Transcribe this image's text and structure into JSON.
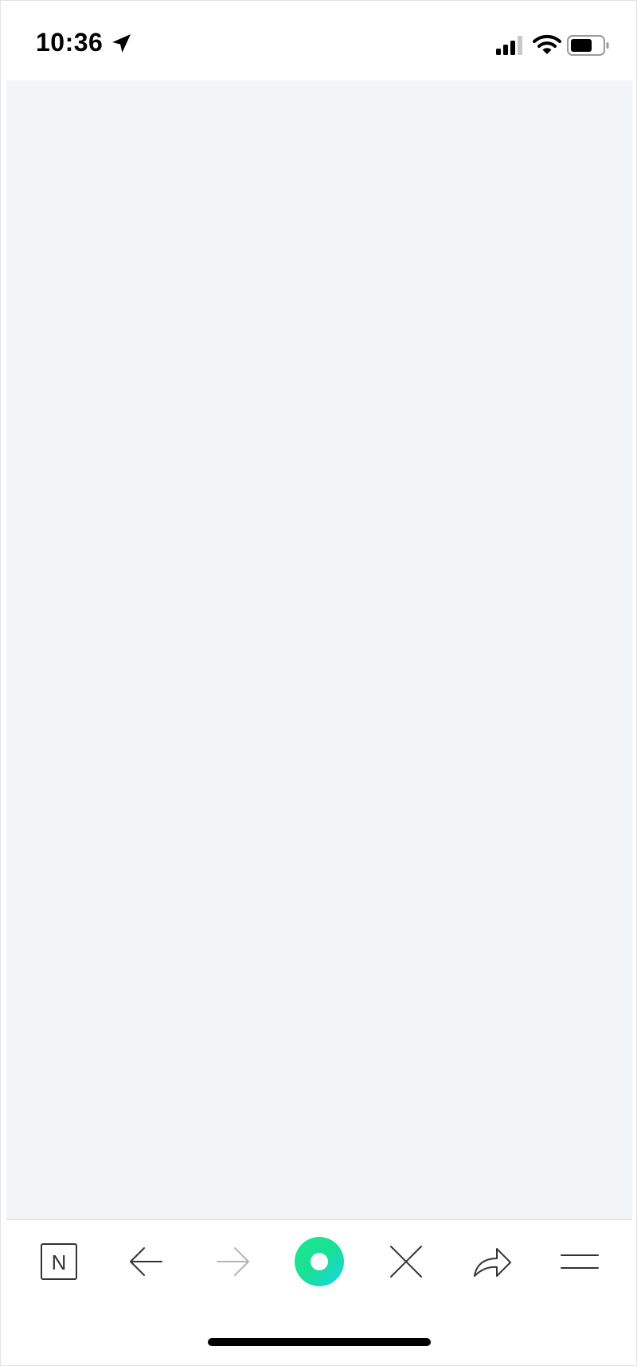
{
  "status_bar": {
    "time": "10:36",
    "icons": [
      "location-arrow-icon",
      "signal-icon",
      "wifi-icon",
      "battery-icon"
    ]
  },
  "toolbar": {
    "items": [
      {
        "name": "notion-logo-icon",
        "label": "N",
        "enabled": true
      },
      {
        "name": "back-arrow-icon",
        "enabled": true
      },
      {
        "name": "forward-arrow-icon",
        "enabled": false
      },
      {
        "name": "home-circle-icon",
        "enabled": true
      },
      {
        "name": "close-icon",
        "enabled": true
      },
      {
        "name": "share-icon",
        "enabled": true
      },
      {
        "name": "menu-icon",
        "enabled": true
      }
    ]
  },
  "colors": {
    "content_bg": "#f3f4f6",
    "accent_start": "#1de88a",
    "accent_end": "#18d4e6",
    "icon": "#333333",
    "icon_disabled": "#b5b5b5"
  }
}
